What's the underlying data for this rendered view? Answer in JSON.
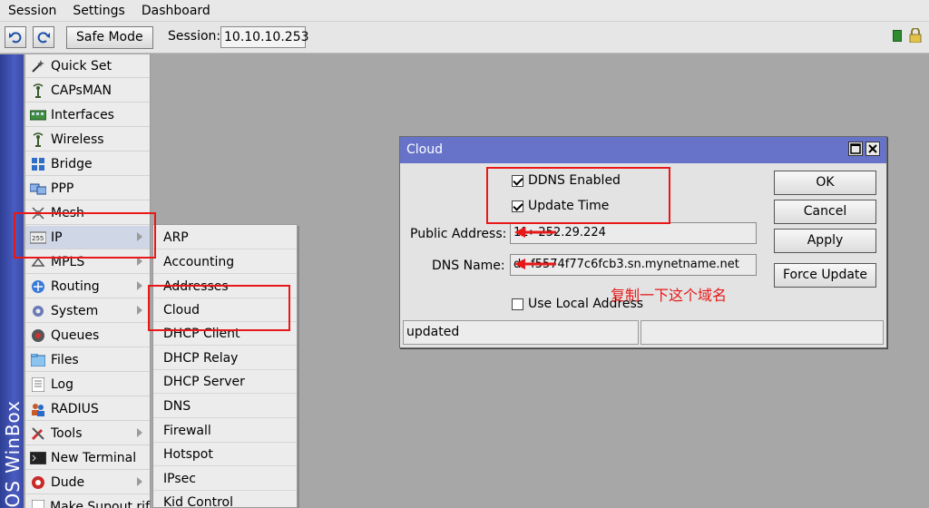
{
  "menubar": {
    "items": [
      "Session",
      "Settings",
      "Dashboard"
    ]
  },
  "toolbar": {
    "undo_icon": "undo-icon",
    "redo_icon": "redo-icon",
    "safe_mode_label": "Safe Mode",
    "session_label": "Session:",
    "session_value": "10.10.10.253"
  },
  "brand": {
    "text": "OS WinBox"
  },
  "main_menu": {
    "items": [
      {
        "label": "Quick Set",
        "icon": "wand-icon"
      },
      {
        "label": "CAPsMAN",
        "icon": "antenna-icon"
      },
      {
        "label": "Interfaces",
        "icon": "interfaces-icon"
      },
      {
        "label": "Wireless",
        "icon": "antenna-icon"
      },
      {
        "label": "Bridge",
        "icon": "bridge-icon"
      },
      {
        "label": "PPP",
        "icon": "ppp-icon"
      },
      {
        "label": "Mesh",
        "icon": "mesh-icon"
      },
      {
        "label": "IP",
        "icon": "ip-icon"
      },
      {
        "label": "MPLS",
        "icon": "mpls-icon"
      },
      {
        "label": "Routing",
        "icon": "routing-icon"
      },
      {
        "label": "System",
        "icon": "gear-icon"
      },
      {
        "label": "Queues",
        "icon": "queues-icon"
      },
      {
        "label": "Files",
        "icon": "folder-icon"
      },
      {
        "label": "Log",
        "icon": "log-icon"
      },
      {
        "label": "RADIUS",
        "icon": "users-icon"
      },
      {
        "label": "Tools",
        "icon": "tools-icon"
      },
      {
        "label": "New Terminal",
        "icon": "terminal-icon"
      },
      {
        "label": "Dude",
        "icon": "dude-icon"
      },
      {
        "label": "Make Supout.rif",
        "icon": "file-icon"
      }
    ]
  },
  "submenu": {
    "items": [
      "ARP",
      "Accounting",
      "Addresses",
      "Cloud",
      "DHCP Client",
      "DHCP Relay",
      "DHCP Server",
      "DNS",
      "Firewall",
      "Hotspot",
      "IPsec",
      "Kid Control"
    ]
  },
  "cloud_dialog": {
    "title": "Cloud",
    "ddns_enabled_label": "DDNS Enabled",
    "ddns_enabled_checked": true,
    "update_time_label": "Update Time",
    "update_time_checked": true,
    "public_address_label": "Public Address:",
    "public_address_value": "11←252.29.224",
    "dns_name_label": "DNS Name:",
    "dns_name_value": "d←f5574f77c6fcb3.sn.mynetname.net",
    "use_local_address_label": "Use Local Address",
    "use_local_address_checked": false,
    "buttons": {
      "ok": "OK",
      "cancel": "Cancel",
      "apply": "Apply",
      "force_update": "Force Update"
    },
    "status": "updated"
  },
  "annotation": {
    "text": "复制一下这个域名",
    "color": "#e81818"
  },
  "colors": {
    "title_bar": "#6673c8",
    "brand_strip": "#3a4aa8",
    "annotation": "#e81818"
  }
}
